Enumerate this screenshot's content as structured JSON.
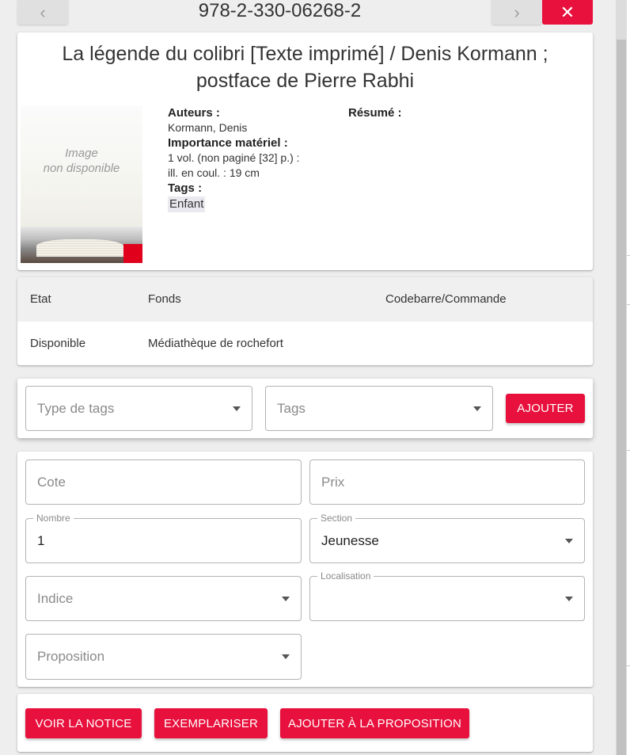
{
  "header": {
    "isbn": "978-2-330-06268-2",
    "prev_icon": "chevron-left-icon",
    "next_icon": "chevron-right-icon",
    "close_icon": "close-icon"
  },
  "notice": {
    "title": "La légende du colibri [Texte imprimé] / Denis Kormann ; postface de Pierre Rabhi",
    "cover_placeholder_line1": "Image",
    "cover_placeholder_line2": "non disponible",
    "authors_label": "Auteurs :",
    "authors_value": "Kormann, Denis",
    "material_label": "Importance matériel :",
    "material_value_line1": "1 vol. (non paginé [32] p.) :",
    "material_value_line2": "ill. en coul. : 19 cm",
    "tags_label": "Tags :",
    "tag": "Enfant",
    "summary_label": "Résumé :"
  },
  "holdings": {
    "columns": [
      "Etat",
      "Fonds",
      "Codebarre/Commande"
    ],
    "rows": [
      [
        "Disponible",
        "Médiathèque de rochefort",
        ""
      ]
    ]
  },
  "tag_form": {
    "tag_type_placeholder": "Type de tags",
    "tags_placeholder": "Tags",
    "add_label": "AJOUTER"
  },
  "copy_form": {
    "cote_placeholder": "Cote",
    "prix_placeholder": "Prix",
    "nombre_label": "Nombre",
    "nombre_value": "1",
    "section_label": "Section",
    "section_value": "Jeunesse",
    "indice_placeholder": "Indice",
    "localisation_label": "Localisation",
    "localisation_value": "",
    "proposition_placeholder": "Proposition"
  },
  "actions": {
    "view_notice": "VOIR LA NOTICE",
    "exemplariser": "EXEMPLARISER",
    "add_to_proposal": "AJOUTER À LA PROPOSITION"
  },
  "colors": {
    "accent": "#e8103c",
    "background": "#eeeeee",
    "card": "#ffffff"
  }
}
